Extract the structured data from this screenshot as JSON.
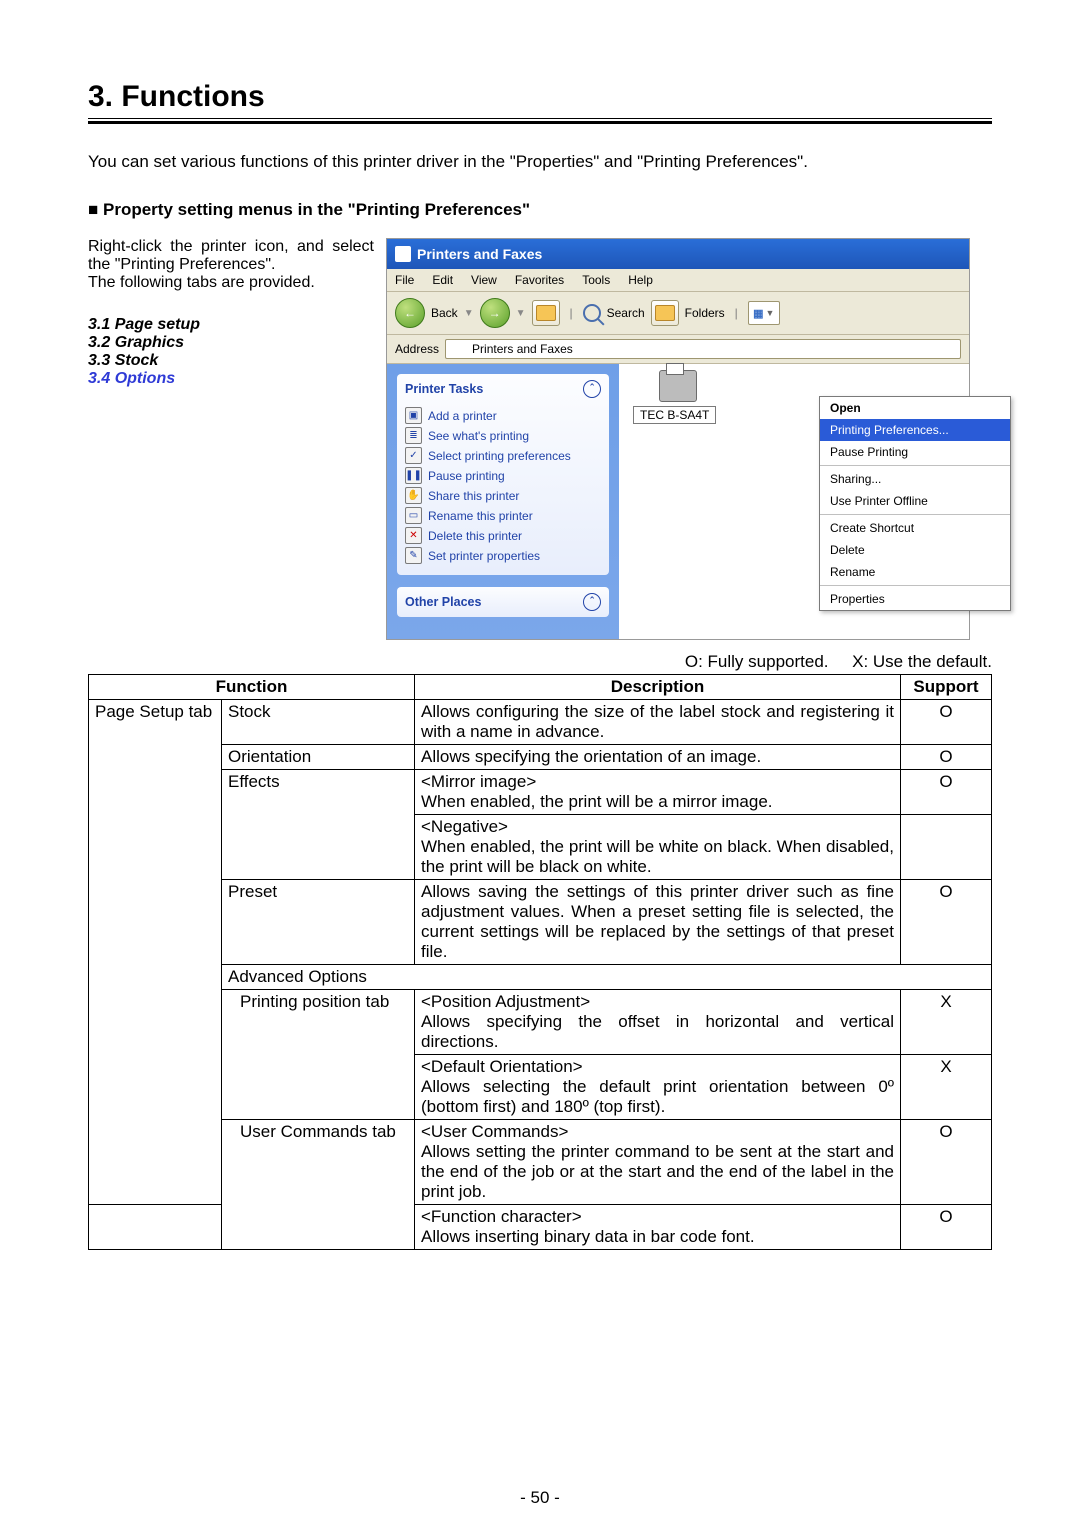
{
  "heading": "3.  Functions",
  "intro": "You can set various functions of this printer driver in the \"Properties\" and \"Printing Preferences\".",
  "subheading": "Property setting menus in the \"Printing Preferences\"",
  "left_p1": "Right-click the printer icon, and select the \"Printing Preferences\".",
  "left_p2": "The following tabs are provided.",
  "tabs": {
    "t1": "3.1 Page setup",
    "t2": "3.2 Graphics",
    "t3": "3.3 Stock",
    "t4": "3.4 Options"
  },
  "window": {
    "title": "Printers and Faxes",
    "menus": [
      "File",
      "Edit",
      "View",
      "Favorites",
      "Tools",
      "Help"
    ],
    "toolbar": {
      "back": "Back",
      "search": "Search",
      "folders": "Folders"
    },
    "address_label": "Address",
    "address_value": "Printers and Faxes",
    "side": {
      "printer_tasks_title": "Printer Tasks",
      "printer_tasks_items": [
        "Add a printer",
        "See what's printing",
        "Select printing preferences",
        "Pause printing",
        "Share this printer",
        "Rename this printer",
        "Delete this printer",
        "Set printer properties"
      ],
      "other_places_title": "Other Places"
    },
    "printer_label": "TEC B-SA4T",
    "context_menu": [
      {
        "label": "Open",
        "bold": true
      },
      {
        "label": "Printing Preferences...",
        "selected": true
      },
      {
        "label": "Pause Printing"
      },
      {
        "sep": true
      },
      {
        "label": "Sharing..."
      },
      {
        "label": "Use Printer Offline"
      },
      {
        "sep": true
      },
      {
        "label": "Create Shortcut"
      },
      {
        "label": "Delete"
      },
      {
        "label": "Rename"
      },
      {
        "sep": true
      },
      {
        "label": "Properties"
      }
    ]
  },
  "legend_o": "O: Fully supported.",
  "legend_x": "X: Use the default.",
  "table": {
    "h_function": "Function",
    "h_description": "Description",
    "h_support": "Support",
    "cat_page_setup": "Page Setup tab",
    "cat_adv_options": "Advanced Options",
    "rows": [
      {
        "f2": "Stock",
        "d": "Allows configuring the size of the label stock and registering it with a name in advance.",
        "s": "O"
      },
      {
        "f2": "Orientation",
        "d": "Allows specifying the orientation of an image.",
        "s": "O"
      },
      {
        "f2": "Effects",
        "d": "<Mirror image>\nWhen enabled, the print will be a mirror image.",
        "s": "O"
      },
      {
        "d": "<Negative>\nWhen enabled, the print will be white on black. When disabled, the print will be black on white.",
        "s": ""
      },
      {
        "f2": "Preset",
        "d": "Allows saving the settings of this printer driver such as fine adjustment values.  When a preset setting file is selected, the current settings will be replaced by the settings of that preset file.",
        "s": "O"
      },
      {
        "f2": "Printing position tab",
        "adv": true,
        "d": "<Position Adjustment>\nAllows specifying the offset in horizontal and vertical directions.",
        "s": "X"
      },
      {
        "adv_cont": true,
        "d": "<Default Orientation>\nAllows selecting the default print orientation between 0º (bottom first) and 180º (top first).",
        "s": "X"
      },
      {
        "f2": "User Commands tab",
        "adv": true,
        "d": "<User Commands>\nAllows setting the printer command to be sent at the start and the end of the job or at the start and the end of the label in the print job.",
        "s": "O"
      },
      {
        "adv_cont": true,
        "d": "<Function character>\nAllows inserting binary data in bar code font.",
        "s": "O"
      }
    ]
  },
  "page_number": "- 50 -"
}
